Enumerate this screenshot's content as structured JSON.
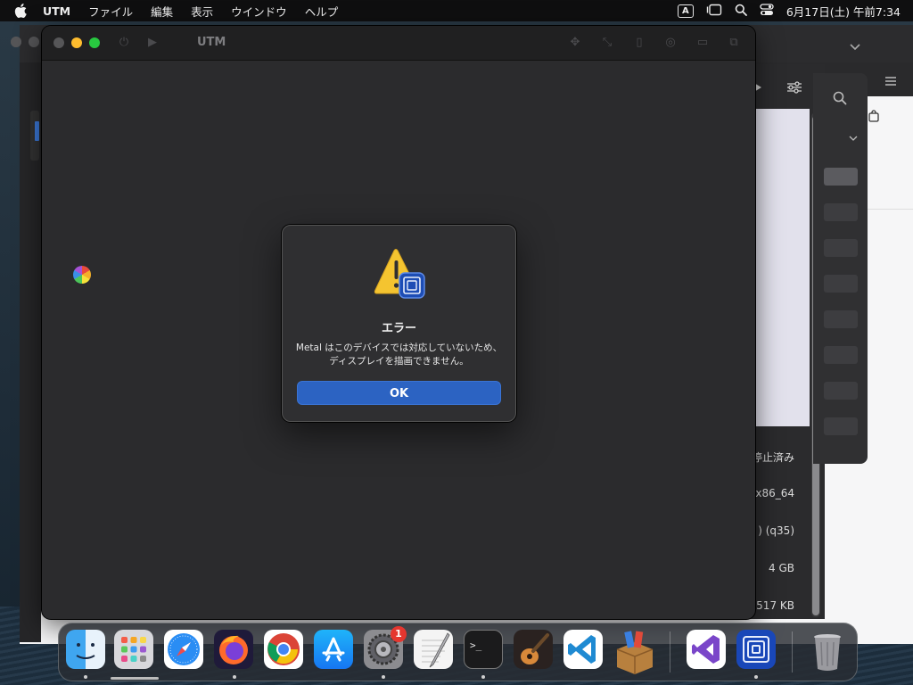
{
  "menubar": {
    "app_name": "UTM",
    "items": [
      "ファイル",
      "編集",
      "表示",
      "ウインドウ",
      "ヘルプ"
    ],
    "input_indicator": "A",
    "datetime": "6月17日(土) 午前7:34"
  },
  "window": {
    "title": "UTM"
  },
  "vm_details": {
    "status": "停止済み",
    "architecture": "x86_64",
    "machine": ") (q35)",
    "memory": "4 GB",
    "size": "517 KB"
  },
  "dialog": {
    "title": "エラー",
    "message": "Metal はこのデバイスでは対応していないため、ディスプレイを描画できません。",
    "ok_label": "OK"
  },
  "dock": {
    "apps": [
      "finder",
      "launchpad",
      "safari",
      "firefox",
      "chrome",
      "app-store",
      "system-settings",
      "textedit",
      "terminal",
      "garageband",
      "vscode",
      "installer",
      "visual-studio",
      "utm",
      "trash"
    ],
    "system_settings_badge": "1"
  },
  "colors": {
    "accent": "#2c63c2",
    "menubar_bg": "#0f0f10",
    "window_bg": "#2b2b2d"
  }
}
